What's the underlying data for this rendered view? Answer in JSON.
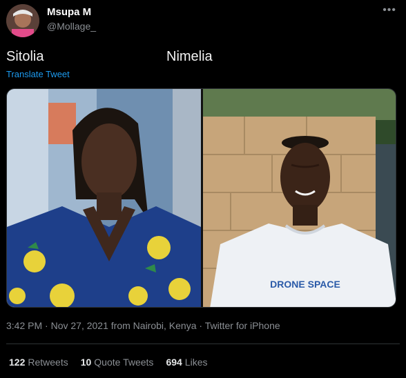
{
  "author": {
    "name": "Msupa M",
    "handle": "@Mollage_",
    "avatar_icon": "profile-photo"
  },
  "tweet": {
    "text_left": "Sitolia",
    "text_right": "Nimelia",
    "translate_label": "Translate Tweet"
  },
  "media": {
    "left_caption": "",
    "right_shirt_text": "DRONE SPACE"
  },
  "meta": {
    "time": "3:42 PM",
    "sep1": " · ",
    "date": "Nov 27, 2021",
    "location": " from Nairobi, Kenya",
    "sep2": " · ",
    "source": "Twitter for iPhone"
  },
  "stats": {
    "retweets_count": "122",
    "retweets_label": "Retweets",
    "quotes_count": "10",
    "quotes_label": "Quote Tweets",
    "likes_count": "694",
    "likes_label": "Likes"
  },
  "colors": {
    "background": "#000000",
    "link": "#1d9bf0",
    "secondary_text": "#8b8f94"
  }
}
